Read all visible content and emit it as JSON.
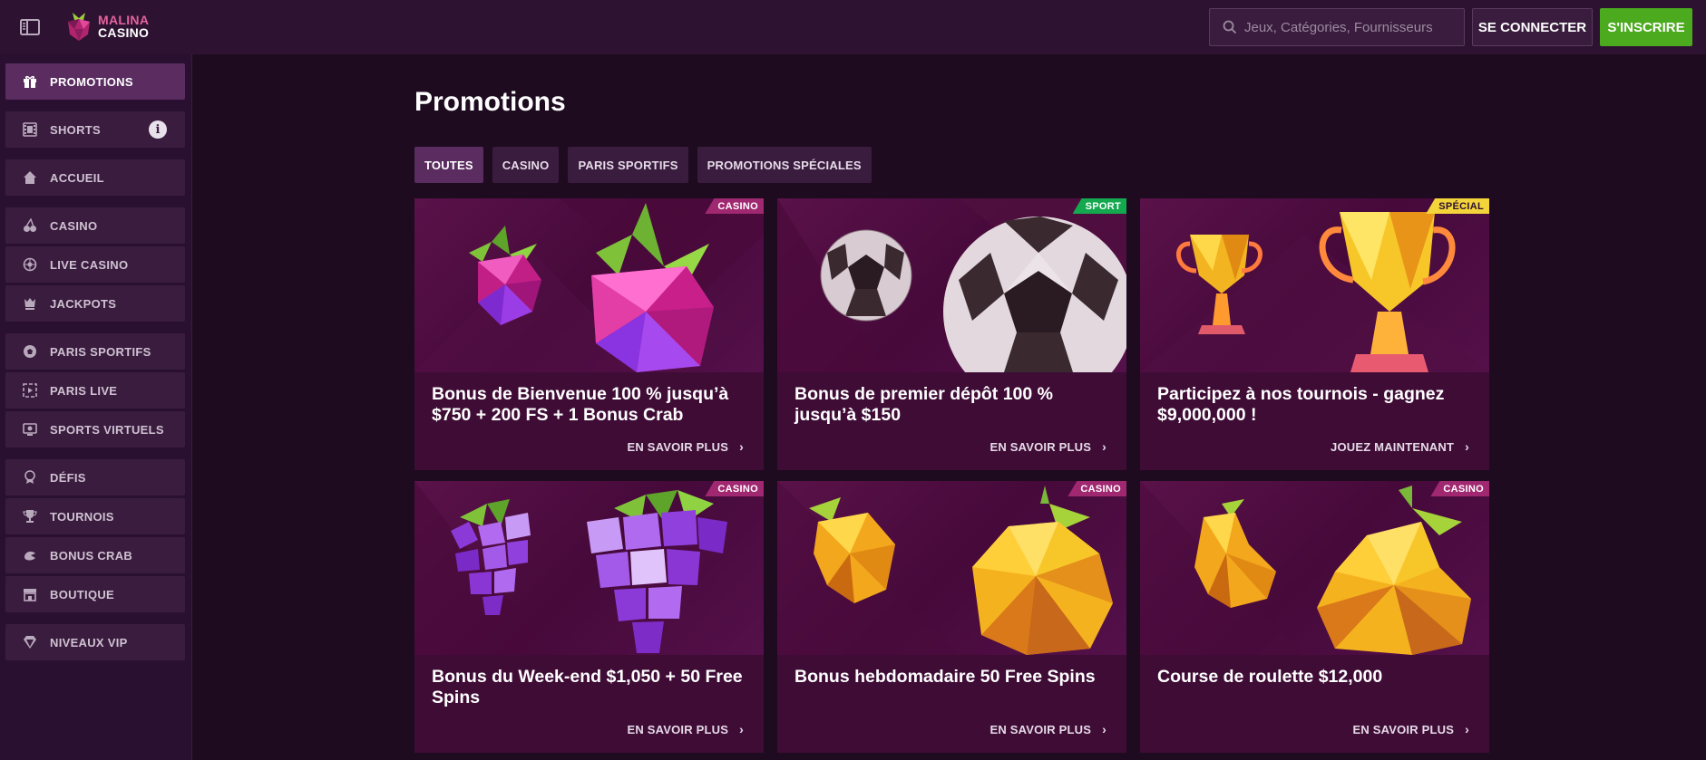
{
  "header": {
    "logo_line1": "MALINA",
    "logo_line2": "CASINO",
    "search_placeholder": "Jeux, Catégories, Fournisseurs",
    "login_label": "SE CONNECTER",
    "signup_label": "S'INSCRIRE"
  },
  "sidebar": {
    "items": [
      {
        "label": "PROMOTIONS",
        "icon": "gift-icon"
      },
      {
        "label": "SHORTS",
        "icon": "film-icon"
      },
      {
        "label": "ACCUEIL",
        "icon": "home-icon"
      },
      {
        "label": "CASINO",
        "icon": "cherries-icon"
      },
      {
        "label": "LIVE CASINO",
        "icon": "roulette-icon"
      },
      {
        "label": "JACKPOTS",
        "icon": "jackpot-icon"
      },
      {
        "label": "PARIS SPORTIFS",
        "icon": "football-icon"
      },
      {
        "label": "PARIS LIVE",
        "icon": "live-icon"
      },
      {
        "label": "SPORTS VIRTUELS",
        "icon": "virtual-icon"
      },
      {
        "label": "DÉFIS",
        "icon": "medal-icon"
      },
      {
        "label": "TOURNOIS",
        "icon": "trophy-icon"
      },
      {
        "label": "BONUS CRAB",
        "icon": "crab-icon"
      },
      {
        "label": "BOUTIQUE",
        "icon": "shop-icon"
      },
      {
        "label": "NIVEAUX VIP",
        "icon": "diamond-icon"
      }
    ],
    "info_glyph": "i"
  },
  "main": {
    "title": "Promotions",
    "tabs": [
      "TOUTES",
      "CASINO",
      "PARIS SPORTIFS",
      "PROMOTIONS SPÉCIALES"
    ],
    "cards": [
      {
        "badge": "CASINO",
        "title": "Bonus de Bienvenue 100 % jusqu’à $750 + 200 FS + 1 Bonus Crab",
        "cta": "EN SAVOIR PLUS",
        "image": "raspberry"
      },
      {
        "badge": "SPORT",
        "title": "Bonus de premier dépôt 100 % jusqu’à $150",
        "cta": "EN SAVOIR PLUS",
        "image": "football"
      },
      {
        "badge": "SPÉCIAL",
        "title": "Participez à nos tournois - gagnez $9,000,000 !",
        "cta": "JOUEZ MAINTENANT",
        "image": "trophy"
      },
      {
        "badge": "CASINO",
        "title": "Bonus du Week-end $1,050 + 50 Free Spins",
        "cta": "EN SAVOIR PLUS",
        "image": "grapes"
      },
      {
        "badge": "CASINO",
        "title": "Bonus hebdomadaire 50 Free Spins",
        "cta": "EN SAVOIR PLUS",
        "image": "lemon"
      },
      {
        "badge": "CASINO",
        "title": "Course de roulette $12,000",
        "cta": "EN SAVOIR PLUS",
        "image": "pear"
      }
    ],
    "cta_chevron": "›"
  },
  "colors": {
    "background": "#1e0b20",
    "header": "#2d1331",
    "sidebar_item": "#3a1c3f",
    "active": "#5a2c60",
    "signup_green": "#4caa1e",
    "badge_casino": "#a02870",
    "badge_sport": "#14a84f",
    "badge_special": "#f4d43b"
  }
}
